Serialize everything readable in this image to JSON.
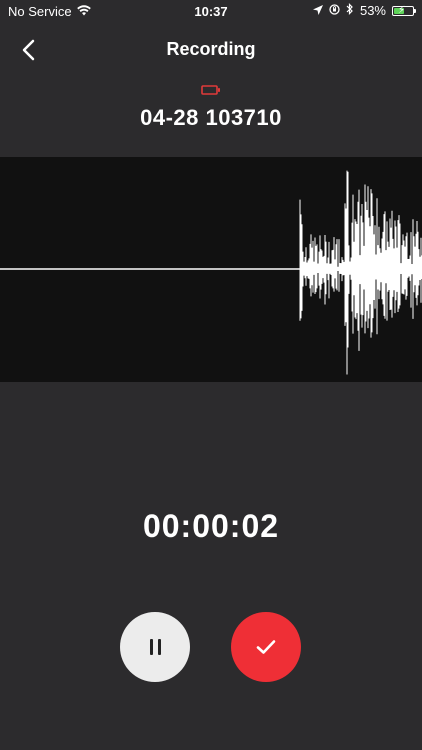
{
  "status_bar": {
    "carrier": "No Service",
    "time": "10:37",
    "battery_percent": "53%",
    "battery_level": 0.53,
    "icons": [
      "wifi-icon",
      "location-icon",
      "orientation-lock-icon",
      "bluetooth-icon",
      "battery-charging-icon"
    ]
  },
  "nav": {
    "title": "Recording",
    "back_icon": "chevron-left-icon"
  },
  "recording": {
    "file_name": "04-28 103710",
    "indicator_icon": "battery-low-icon",
    "indicator_color": "#e03a3a",
    "elapsed": "00:00:02"
  },
  "controls": {
    "pause_icon": "pause-icon",
    "done_icon": "checkmark-icon",
    "done_color": "#ef2f36"
  }
}
